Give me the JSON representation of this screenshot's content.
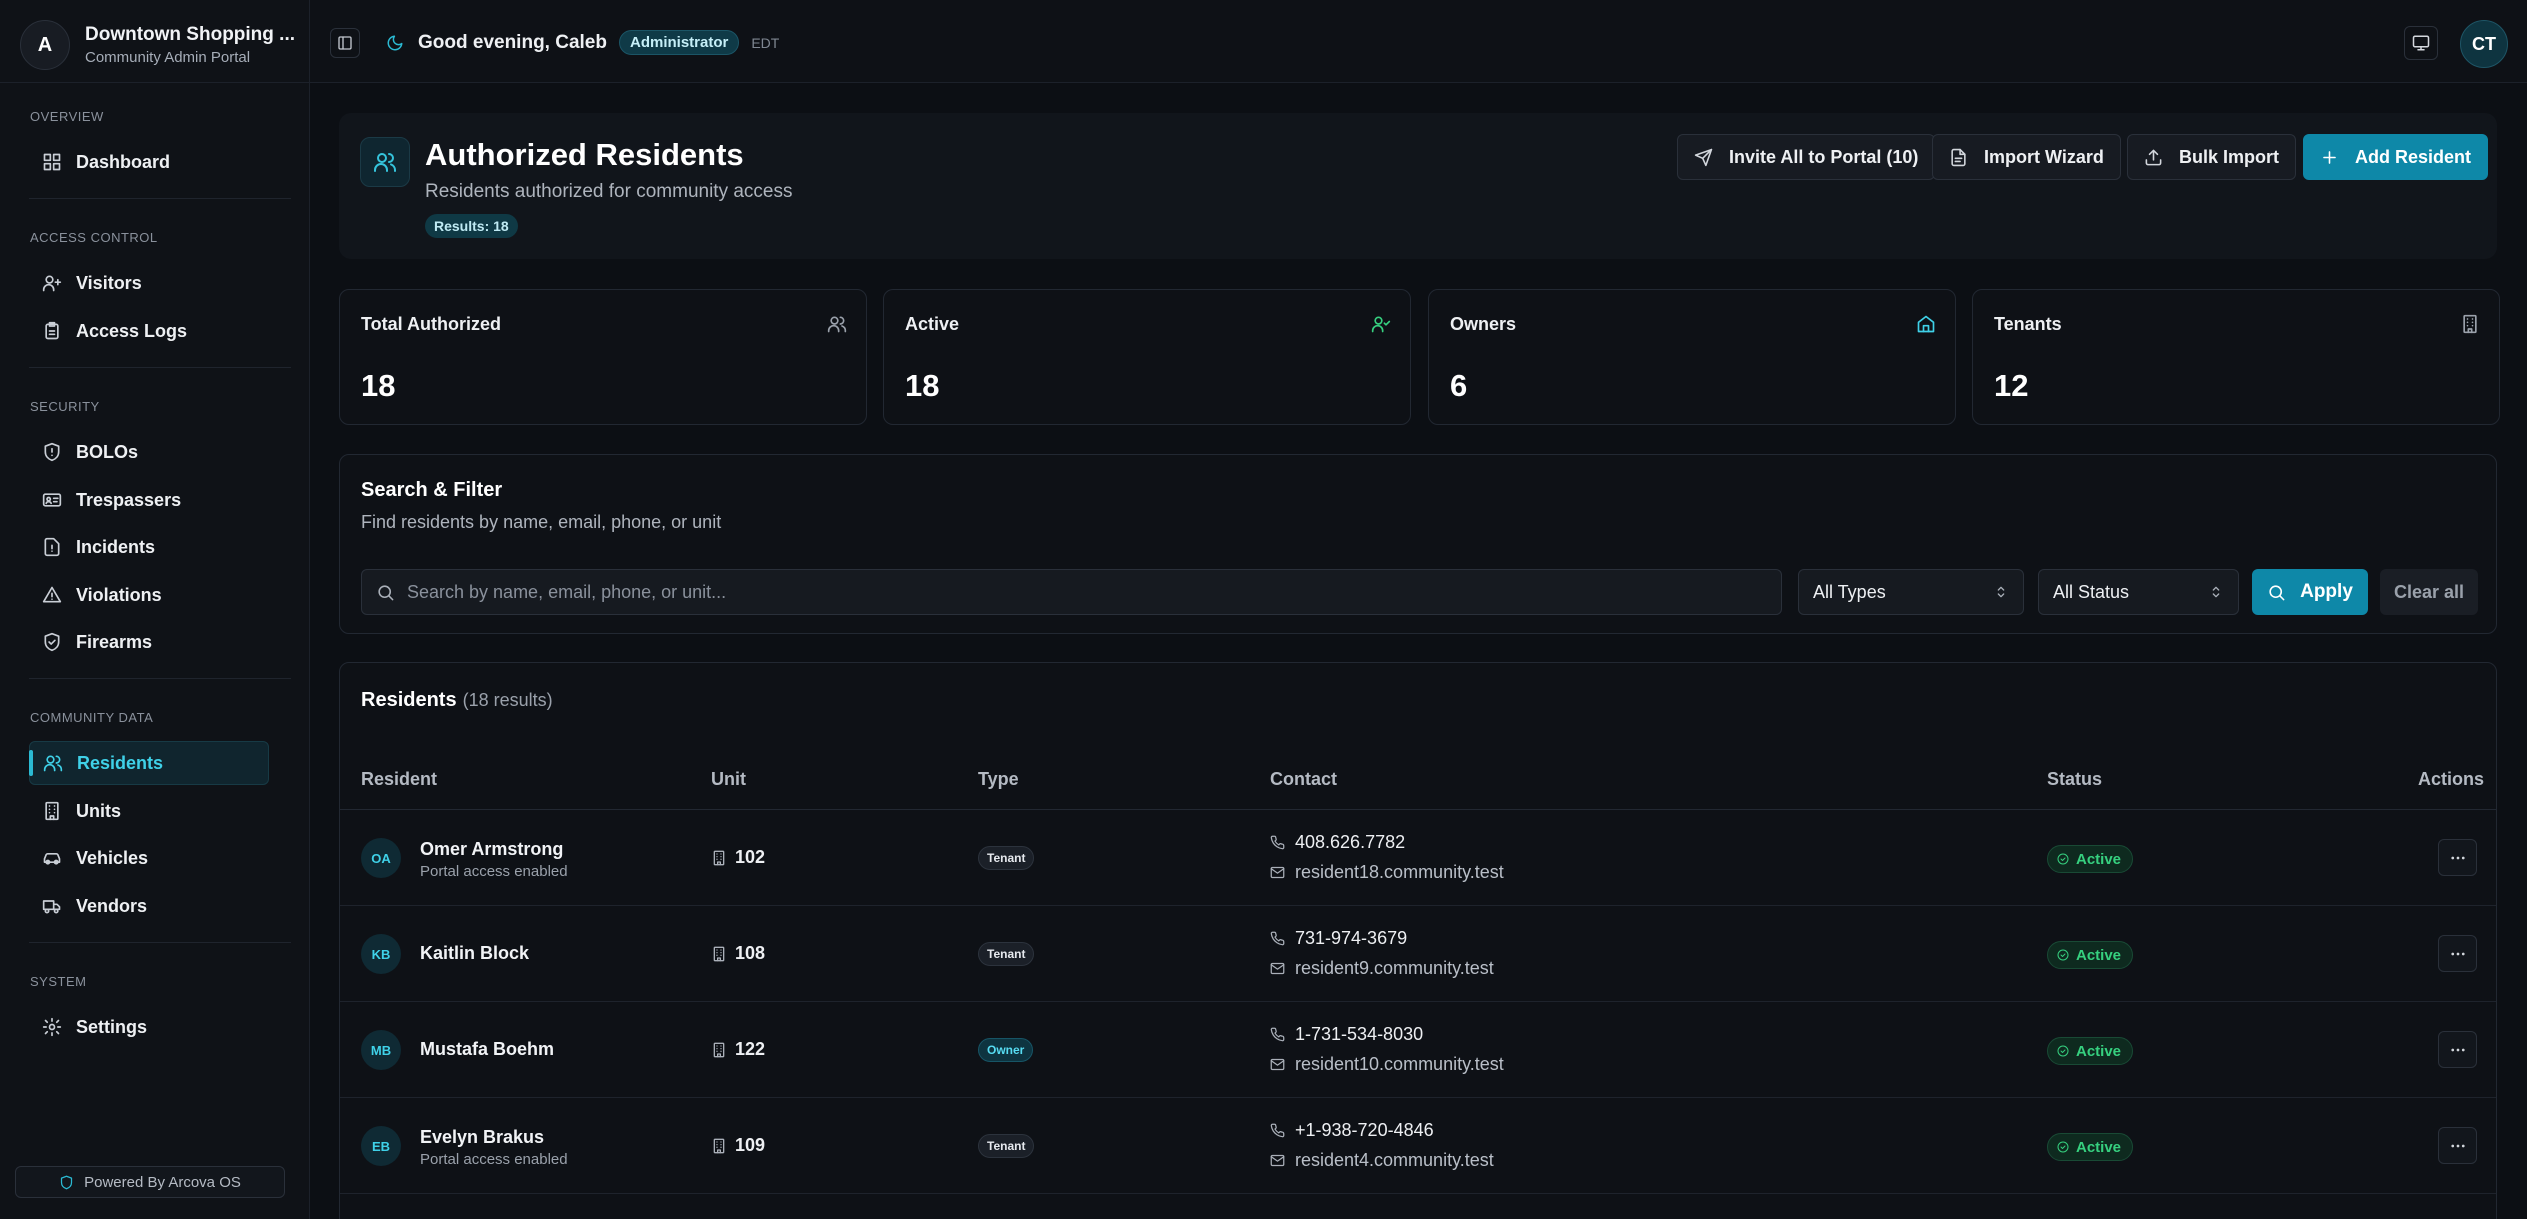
{
  "brand": {
    "logo": "A",
    "title": "Downtown Shopping ...",
    "subtitle": "Community Admin Portal"
  },
  "sidebar": {
    "sections": [
      "Overview",
      "Access Control",
      "Security",
      "Community Data",
      "System"
    ],
    "items": [
      {
        "label": "Dashboard",
        "icon": "grid-icon"
      },
      {
        "label": "Visitors",
        "icon": "user-plus-icon"
      },
      {
        "label": "Access Logs",
        "icon": "clipboard-icon"
      },
      {
        "label": "BOLOs",
        "icon": "shield-alert-icon"
      },
      {
        "label": "Trespassers",
        "icon": "id-card-icon"
      },
      {
        "label": "Incidents",
        "icon": "file-alert-icon"
      },
      {
        "label": "Violations",
        "icon": "warning-icon"
      },
      {
        "label": "Firearms",
        "icon": "shield-check-icon"
      },
      {
        "label": "Residents",
        "icon": "users-icon",
        "active": true
      },
      {
        "label": "Units",
        "icon": "building-icon"
      },
      {
        "label": "Vehicles",
        "icon": "car-icon"
      },
      {
        "label": "Vendors",
        "icon": "truck-icon"
      },
      {
        "label": "Settings",
        "icon": "gear-icon"
      }
    ],
    "powered_by": "Powered By Arcova OS"
  },
  "topbar": {
    "greeting": "Good evening, Caleb",
    "role": "Administrator",
    "timezone": "EDT",
    "user_initials": "CT"
  },
  "header": {
    "title": "Authorized Residents",
    "subtitle": "Residents authorized for community access",
    "results_badge": "Results: 18",
    "buttons": {
      "invite": "Invite All to Portal (10)",
      "import_wizard": "Import Wizard",
      "bulk_import": "Bulk Import",
      "add_resident": "Add Resident"
    }
  },
  "stats": [
    {
      "label": "Total Authorized",
      "value": "18",
      "icon": "users-icon",
      "color": "#9aa1ab"
    },
    {
      "label": "Active",
      "value": "18",
      "icon": "user-check-icon",
      "color": "#36d07f"
    },
    {
      "label": "Owners",
      "value": "6",
      "icon": "home-icon",
      "color": "#3fd1e8"
    },
    {
      "label": "Tenants",
      "value": "12",
      "icon": "building-icon",
      "color": "#9aa1ab"
    }
  ],
  "filter": {
    "title": "Search & Filter",
    "subtitle": "Find residents by name, email, phone, or unit",
    "search_placeholder": "Search by name, email, phone, or unit...",
    "type_select": "All Types",
    "status_select": "All Status",
    "apply": "Apply",
    "clear": "Clear all"
  },
  "table": {
    "title": "Residents",
    "count": "(18 results)",
    "columns": [
      "Resident",
      "Unit",
      "Type",
      "Contact",
      "Status",
      "Actions"
    ],
    "rows": [
      {
        "initials": "OA",
        "name": "Omer Armstrong",
        "note": "Portal access enabled",
        "unit": "102",
        "type": "Tenant",
        "phone": "408.626.7782",
        "email": "resident18.community.test",
        "status": "Active"
      },
      {
        "initials": "KB",
        "name": "Kaitlin Block",
        "note": "",
        "unit": "108",
        "type": "Tenant",
        "phone": "731-974-3679",
        "email": "resident9.community.test",
        "status": "Active"
      },
      {
        "initials": "MB",
        "name": "Mustafa Boehm",
        "note": "",
        "unit": "122",
        "type": "Owner",
        "phone": "1-731-534-8030",
        "email": "resident10.community.test",
        "status": "Active"
      },
      {
        "initials": "EB",
        "name": "Evelyn Brakus",
        "note": "Portal access enabled",
        "unit": "109",
        "type": "Tenant",
        "phone": "+1-938-720-4846",
        "email": "resident4.community.test",
        "status": "Active"
      }
    ]
  },
  "colors": {
    "accent": "#0e88a8",
    "accent_text": "#3fd1e8",
    "success": "#36d07f",
    "background": "#0c0f14"
  }
}
